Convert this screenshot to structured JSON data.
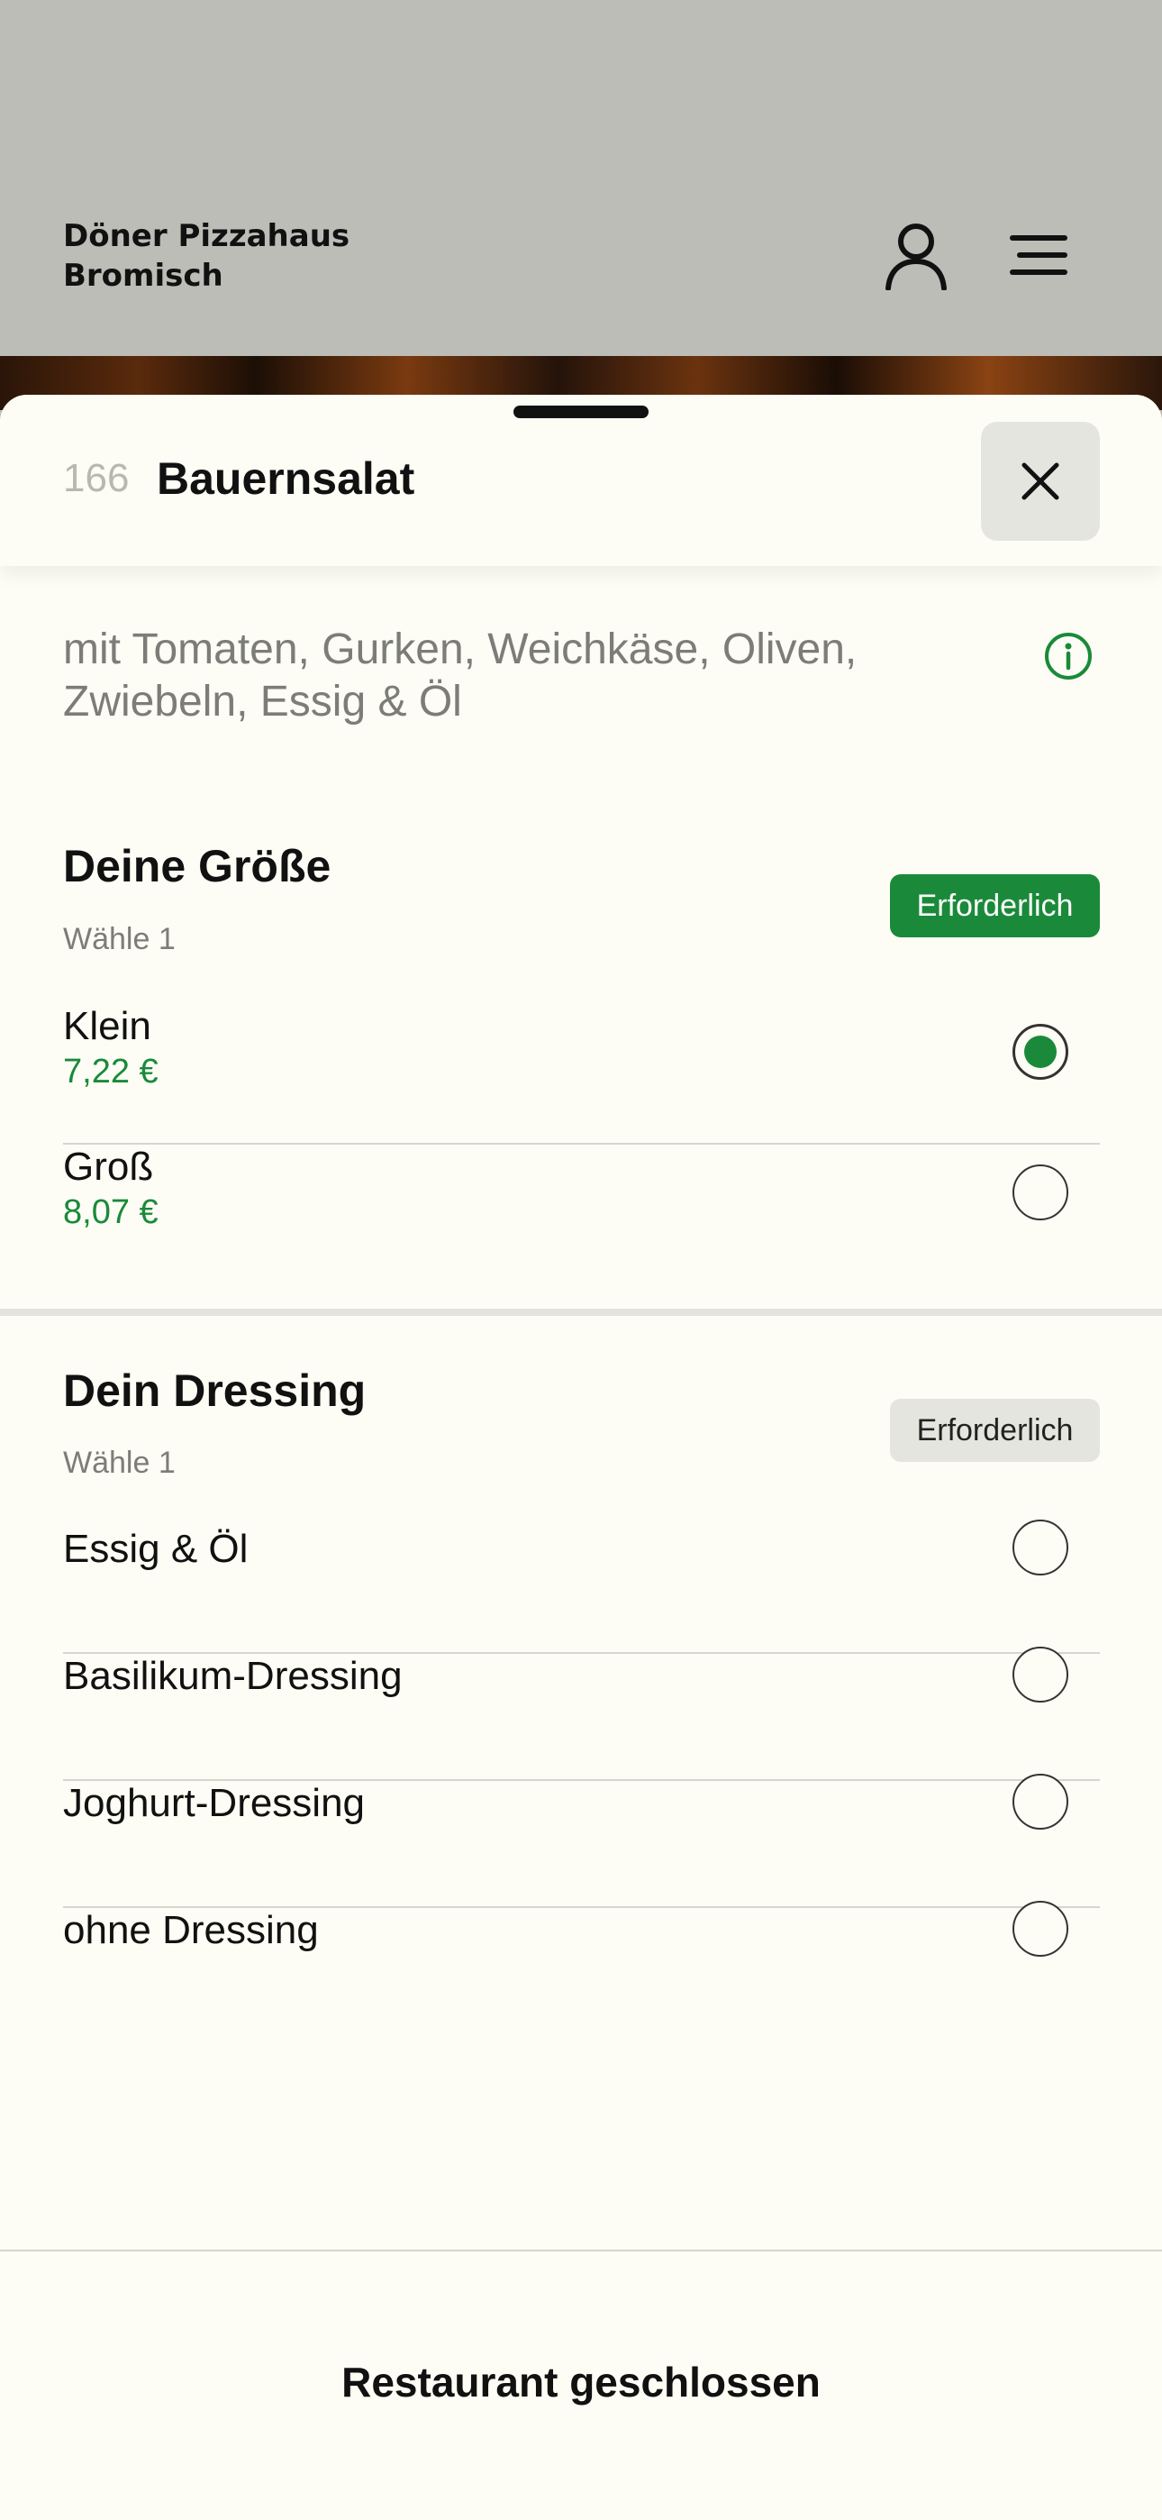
{
  "restaurant": {
    "name_line1": "Döner Pizzahaus",
    "name_line2": "Bromisch"
  },
  "icons": {
    "user": "user-icon",
    "menu": "menu-icon",
    "close": "close-icon",
    "info": "info-icon"
  },
  "item": {
    "number": "166",
    "title": "Bauernsalat",
    "description": "mit Tomaten, Gurken, Weichkäse, Oliven, Zwiebeln, Essig & Öl"
  },
  "groups": [
    {
      "title": "Deine Größe",
      "subtitle": "Wähle 1",
      "badge": "Erforderlich",
      "options": [
        {
          "label": "Klein",
          "price": "7,22 €",
          "selected": true
        },
        {
          "label": "Groß",
          "price": "8,07 €",
          "selected": false
        }
      ]
    },
    {
      "title": "Dein Dressing",
      "subtitle": "Wähle 1",
      "badge": "Erforderlich",
      "options": [
        {
          "label": "Essig & Öl",
          "selected": false
        },
        {
          "label": "Basilikum-Dressing",
          "selected": false
        },
        {
          "label": "Joghurt-Dressing",
          "selected": false
        },
        {
          "label": "ohne Dressing",
          "selected": false
        }
      ]
    }
  ],
  "footer": {
    "status": "Restaurant geschlossen"
  },
  "colors": {
    "accent_green": "#1a8a3a",
    "sheet_bg": "#fdfdf5",
    "header_bg": "#bdbdb8"
  }
}
